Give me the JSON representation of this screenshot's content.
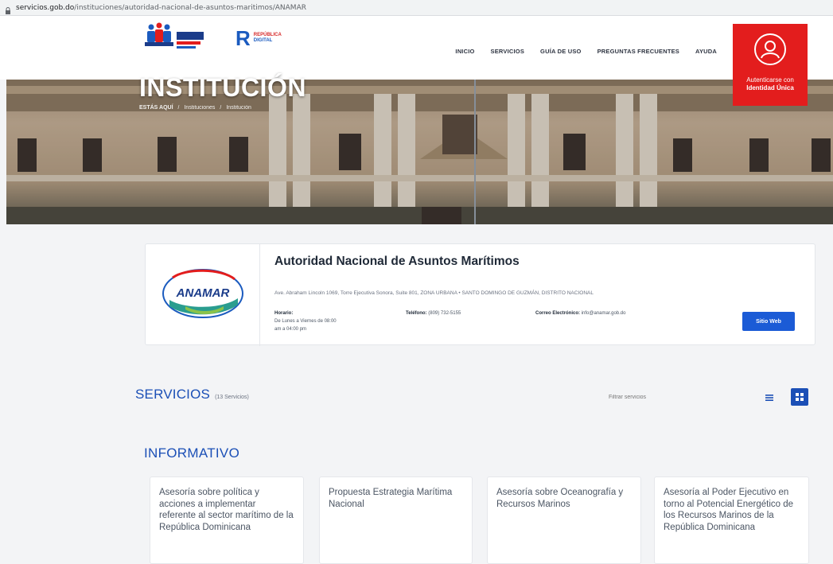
{
  "browser": {
    "url_domain": "servicios.gob.do",
    "url_path": "/instituciones/autoridad-nacional-de-asuntos-maritimos/ANAMAR"
  },
  "header": {
    "nav": [
      "INICIO",
      "SERVICIOS",
      "GUÍA DE USO",
      "PREGUNTAS FRECUENTES",
      "AYUDA"
    ],
    "republica_digital": [
      "REPÚBLICA",
      "DIGITAL"
    ],
    "auth_line1": "Autenticarse con",
    "auth_line2": "Identidad Única",
    "colors": {
      "accent_red": "#e31d1d",
      "brand_blue": "#1b4fb6"
    }
  },
  "hero": {
    "title": "INSTITUCIÓN",
    "breadcrumb": [
      "ESTÁS AQUÍ",
      "Instituciones",
      "Institución"
    ]
  },
  "institution": {
    "logo_text": "ANAMAR",
    "name": "Autoridad Nacional de Asuntos Marítimos",
    "address": "Ave. Abraham Lincoln 1069, Torre Ejecutiva Sonora, Suite 801, ZONA URBANA • SANTO DOMINGO DE GUZMÁN, DISTRITO NACIONAL",
    "horario_label": "Horario:",
    "horario_line1": "De Lunes a Viernes de 08:00",
    "horario_line2": "am a 04:00 pm",
    "telefono_label": "Teléfono:",
    "telefono": "(809) 732-5155",
    "correo_label": "Correo Electrónico:",
    "correo": "info@anamar.gob.do",
    "web_button": "Sitio Web"
  },
  "servicios": {
    "title": "SERVICIOS",
    "count": "(13 Servicios)",
    "filter_placeholder": "Filtrar servicios"
  },
  "category": "INFORMATIVO",
  "cards": [
    "Asesoría sobre política y acciones a implementar referente al sector marítimo de la República Dominicana",
    "Propuesta Estrategia Marítima Nacional",
    "Asesoría sobre Oceanografía y Recursos Marinos",
    "Asesoría al Poder Ejecutivo en torno al Potencial Energético de los Recursos Marinos de la República Dominicana"
  ]
}
